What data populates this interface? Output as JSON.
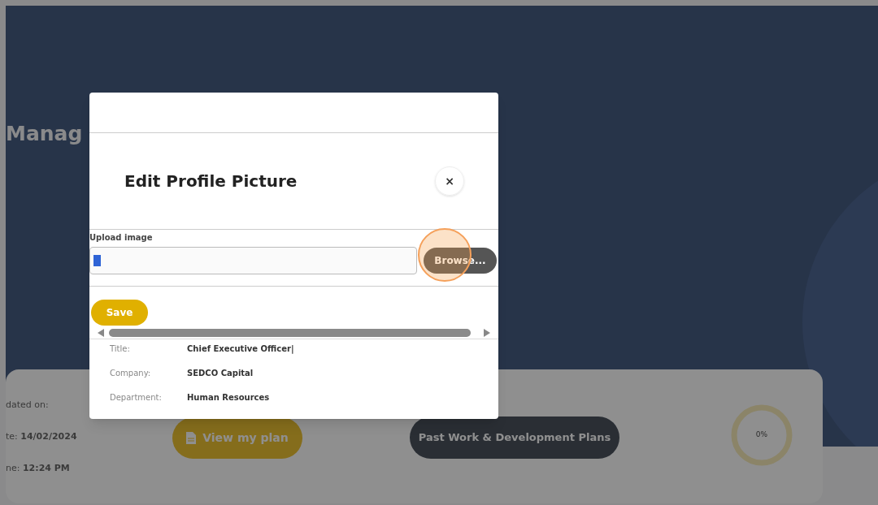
{
  "page": {
    "title": "Manag"
  },
  "card": {
    "updated_label": "dated on:",
    "date": "te: **14/02/2024**",
    "time": "ne: **12:24 PM**",
    "view_button": "View my plan",
    "past_button": "Past Work & Development Plans",
    "progress": {
      "level": 0,
      "reading": "0%"
    }
  },
  "modal": {
    "title": "Edit Profile Picture",
    "close": "×",
    "upload_label": "Upload image",
    "browse_button": "Browse...",
    "save_button": "Save",
    "details": [
      {
        "label": "Title:",
        "value": "Chief Executive Officer|"
      },
      {
        "label": "Company:",
        "value": "SEDCO Capital"
      },
      {
        "label": "Department:",
        "value": "Human Resources"
      }
    ]
  }
}
